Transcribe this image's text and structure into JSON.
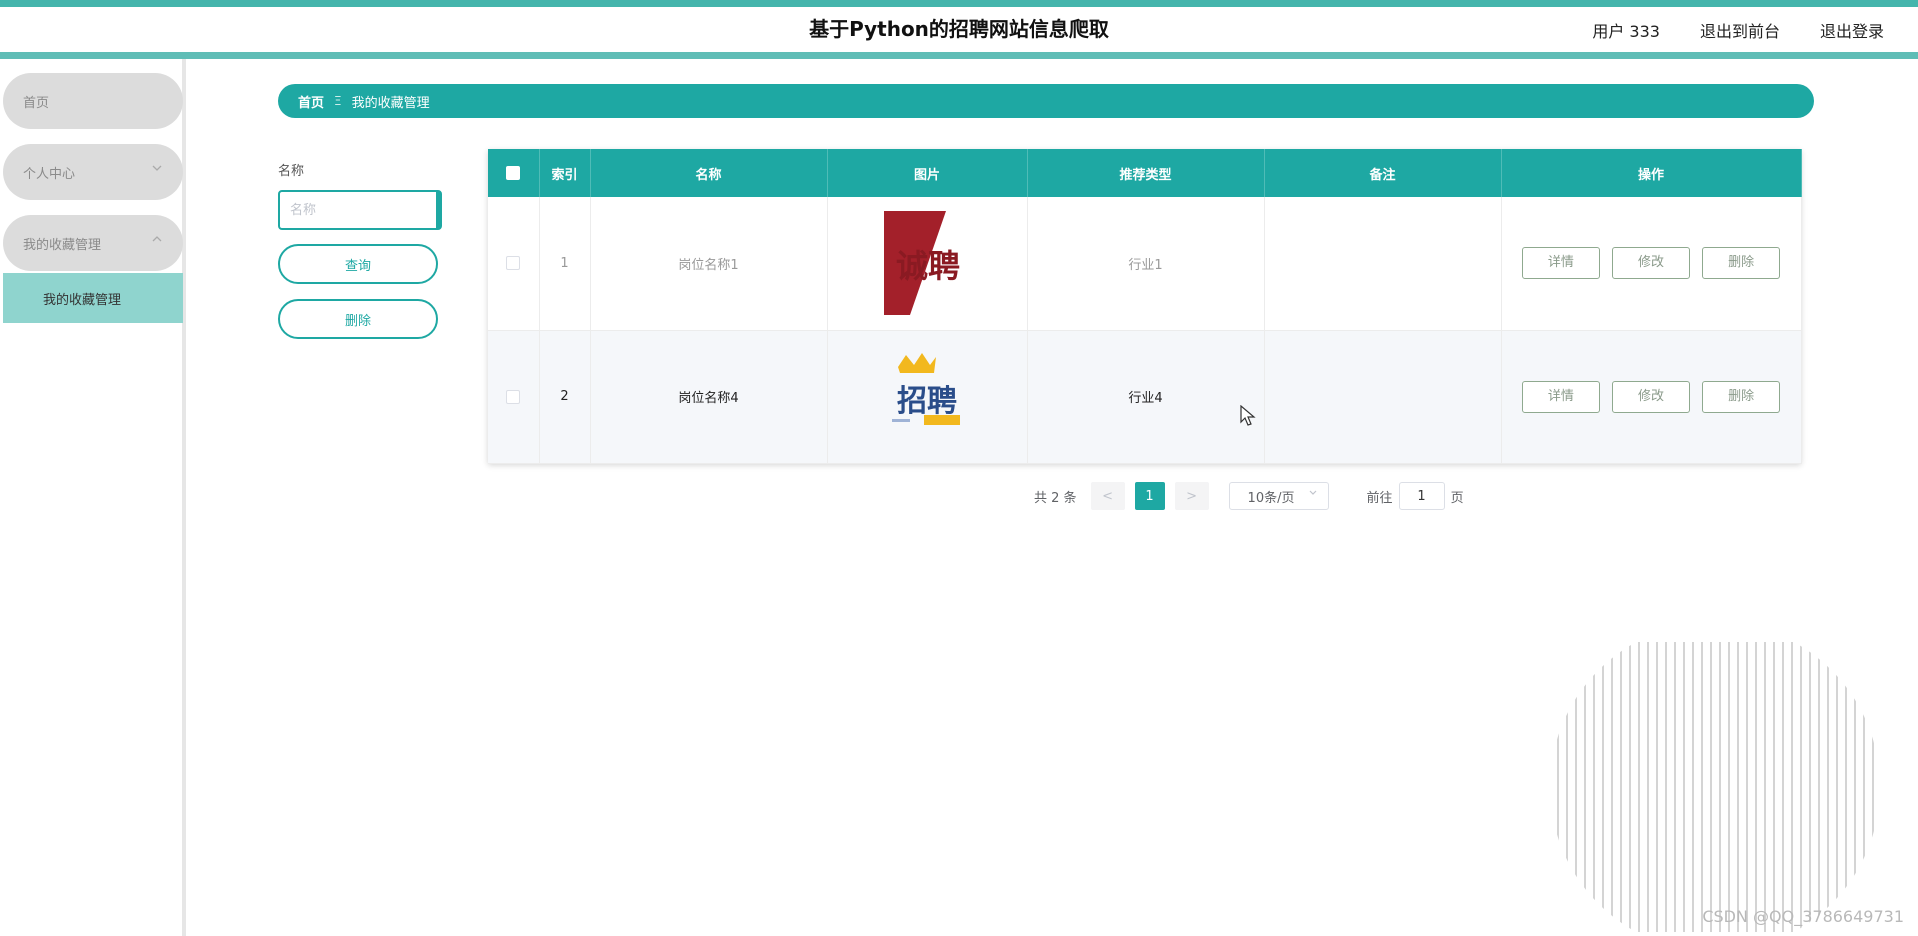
{
  "header": {
    "title": "基于Python的招聘网站信息爬取",
    "user": "用户 333",
    "back_front": "退出到前台",
    "logout": "退出登录",
    "accent_color": "#45b5ac"
  },
  "sidebar": {
    "items": [
      {
        "label": "首页"
      },
      {
        "label": "个人中心",
        "icon": "chevron-down-icon"
      },
      {
        "label": "我的收藏管理",
        "icon": "chevron-up-icon"
      }
    ],
    "sub_item": "我的收藏管理"
  },
  "breadcrumb": {
    "home": "首页",
    "separator": "Ξ",
    "current": "我的收藏管理"
  },
  "search": {
    "label": "名称",
    "placeholder": "名称",
    "query_button": "查询",
    "delete_button": "删除"
  },
  "table": {
    "headers": [
      "索引",
      "名称",
      "图片",
      "推荐类型",
      "备注",
      "操作"
    ],
    "rows": [
      {
        "index": "1",
        "name": "岗位名称1",
        "image_text": "诚聘",
        "type": "行业1",
        "note": ""
      },
      {
        "index": "2",
        "name": "岗位名称4",
        "image_text": "招聘",
        "type": "行业4",
        "note": ""
      }
    ],
    "actions": {
      "detail": "详情",
      "edit": "修改",
      "delete": "删除"
    }
  },
  "pagination": {
    "total": "共 2 条",
    "prev": "<",
    "page": "1",
    "next": ">",
    "page_size": "10条/页",
    "goto_prefix": "前往",
    "goto_value": "1",
    "goto_suffix": "页"
  },
  "watermark": "CSDN @QQ_3786649731"
}
